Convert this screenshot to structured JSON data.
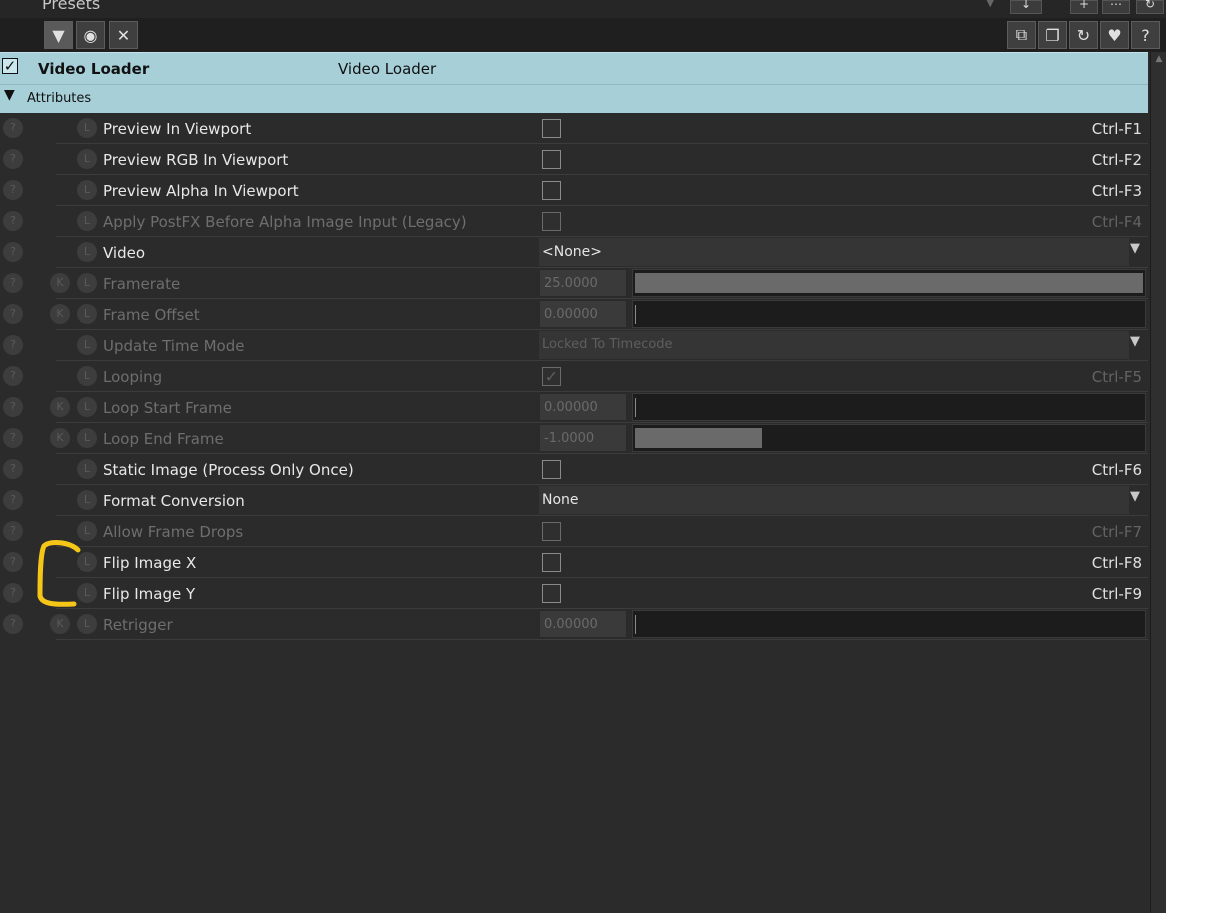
{
  "panel": {
    "title": "Presets",
    "toolbar_left": [
      {
        "name": "filter-icon",
        "glyph": "▼"
      },
      {
        "name": "target-icon",
        "glyph": "◉"
      },
      {
        "name": "clear-icon",
        "glyph": "✕"
      }
    ],
    "toolbar_right": [
      {
        "name": "copy-icon",
        "glyph": "⧉"
      },
      {
        "name": "paste-icon",
        "glyph": "❐"
      },
      {
        "name": "reset-icon",
        "glyph": "↻"
      },
      {
        "name": "favorite-icon",
        "glyph": "♥"
      },
      {
        "name": "help-icon",
        "glyph": "?"
      }
    ],
    "top_mini": [
      "↓",
      "+",
      "⋯",
      "↻"
    ]
  },
  "header": {
    "checked": true,
    "label": "Video Loader",
    "value": "Video Loader"
  },
  "section": {
    "label": "Attributes"
  },
  "row_icons": {
    "help": "?",
    "key": "K",
    "link": "L"
  },
  "rows": [
    {
      "label": "Preview In Viewport",
      "type": "checkbox",
      "checked": false,
      "shortcut": "Ctrl-F1",
      "enabled": true,
      "key": false
    },
    {
      "label": "Preview RGB In Viewport",
      "type": "checkbox",
      "checked": false,
      "shortcut": "Ctrl-F2",
      "enabled": true,
      "key": false
    },
    {
      "label": "Preview Alpha In Viewport",
      "type": "checkbox",
      "checked": false,
      "shortcut": "Ctrl-F3",
      "enabled": true,
      "key": false
    },
    {
      "label": "Apply PostFX Before Alpha Image Input (Legacy)",
      "type": "checkbox",
      "checked": false,
      "shortcut": "Ctrl-F4",
      "enabled": false,
      "key": false
    },
    {
      "label": "Video",
      "type": "dropdown",
      "value": "<None>",
      "enabled": true,
      "key": false
    },
    {
      "label": "Framerate",
      "type": "number",
      "value": "25.0000",
      "fill": 1.0,
      "enabled": false,
      "key": true
    },
    {
      "label": "Frame Offset",
      "type": "number",
      "value": "0.00000",
      "fill": 0,
      "enabled": false,
      "key": true
    },
    {
      "label": "Update Time Mode",
      "type": "dropdown",
      "value": "Locked To Timecode",
      "enabled": false,
      "key": false
    },
    {
      "label": "Looping",
      "type": "checkbox",
      "checked": true,
      "shortcut": "Ctrl-F5",
      "enabled": false,
      "key": false
    },
    {
      "label": "Loop Start Frame",
      "type": "number",
      "value": "0.00000",
      "fill": 0,
      "enabled": false,
      "key": true
    },
    {
      "label": "Loop End Frame",
      "type": "number",
      "value": "-1.0000",
      "fill": 0.25,
      "enabled": false,
      "key": true
    },
    {
      "label": "Static Image (Process Only Once)",
      "type": "checkbox",
      "checked": false,
      "shortcut": "Ctrl-F6",
      "enabled": true,
      "key": false
    },
    {
      "label": "Format Conversion",
      "type": "dropdown",
      "value": "None",
      "enabled": true,
      "key": false
    },
    {
      "label": "Allow Frame Drops",
      "type": "checkbox",
      "checked": false,
      "shortcut": "Ctrl-F7",
      "enabled": false,
      "key": false
    },
    {
      "label": "Flip Image X",
      "type": "checkbox",
      "checked": false,
      "shortcut": "Ctrl-F8",
      "enabled": true,
      "key": false
    },
    {
      "label": "Flip Image Y",
      "type": "checkbox",
      "checked": false,
      "shortcut": "Ctrl-F9",
      "enabled": true,
      "key": false
    },
    {
      "label": "Retrigger",
      "type": "number",
      "value": "0.00000",
      "fill": 0,
      "enabled": false,
      "key": true
    }
  ],
  "annotation_color": "#f5c518"
}
